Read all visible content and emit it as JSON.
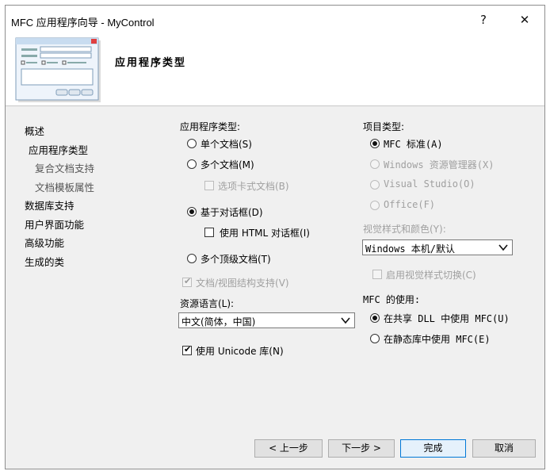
{
  "window": {
    "title": "MFC 应用程序向导 - MyControl",
    "help_label": "?",
    "close_label": "✕"
  },
  "header": {
    "title": "应用程序类型"
  },
  "sidebar": {
    "items": [
      "概述",
      "应用程序类型",
      "复合文档支持",
      "文档模板属性",
      "数据库支持",
      "用户界面功能",
      "高级功能",
      "生成的类"
    ]
  },
  "app_type": {
    "label": "应用程序类型:",
    "single_doc": "单个文档(S)",
    "multi_doc": "多个文档(M)",
    "tabbed_docs": "选项卡式文档(B)",
    "dialog_based": "基于对话框(D)",
    "use_html_dialog": "使用 HTML 对话框(I)",
    "multi_top_level": "多个顶级文档(T)",
    "doc_view_support": "文档/视图结构支持(V)",
    "selected": "dialog_based"
  },
  "resource_lang": {
    "label": "资源语言(L):",
    "value": "中文(简体，中国)"
  },
  "unicode": {
    "label": "使用 Unicode 库(N)",
    "checked": true
  },
  "project_type": {
    "label": "项目类型:",
    "mfc_standard": "MFC 标准(A)",
    "explorer": "Windows 资源管理器(X)",
    "visual_studio": "Visual Studio(O)",
    "office": "Office(F)",
    "selected": "mfc_standard"
  },
  "visual_style": {
    "label": "视觉样式和颜色(Y):",
    "value": "Windows 本机/默认",
    "toggle_label": "启用视觉样式切换(C)"
  },
  "mfc_use": {
    "label": "MFC 的使用:",
    "shared_dll": "在共享 DLL 中使用 MFC(U)",
    "static_lib": "在静态库中使用 MFC(E)",
    "selected": "shared_dll"
  },
  "buttons": {
    "back": "< 上一步",
    "next": "下一步 >",
    "finish": "完成",
    "cancel": "取消"
  }
}
